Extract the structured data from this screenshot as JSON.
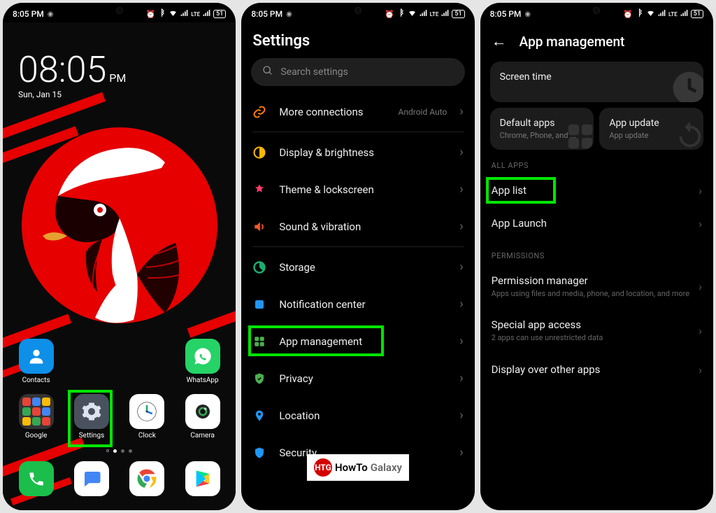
{
  "status": {
    "time": "8:05 PM",
    "battery": "51"
  },
  "home": {
    "clock_time": "08:05",
    "clock_ampm": "PM",
    "clock_date": "Sun, Jan 15",
    "apps_row1": [
      {
        "label": "Contacts"
      },
      {
        "label": ""
      },
      {
        "label": ""
      },
      {
        "label": "WhatsApp"
      }
    ],
    "apps_row2": [
      {
        "label": "Google"
      },
      {
        "label": "Settings"
      },
      {
        "label": "Clock"
      },
      {
        "label": "Camera"
      }
    ],
    "dock": [
      {
        "label": "Phone"
      },
      {
        "label": "Messages"
      },
      {
        "label": "Chrome"
      },
      {
        "label": "Play Store"
      }
    ]
  },
  "settings": {
    "title": "Settings",
    "search_placeholder": "Search settings",
    "items": [
      {
        "label": "More connections",
        "value": "Android Auto"
      },
      {
        "label": "Display & brightness"
      },
      {
        "label": "Theme & lockscreen"
      },
      {
        "label": "Sound & vibration"
      },
      {
        "label": "Storage"
      },
      {
        "label": "Notification center"
      },
      {
        "label": "App management"
      },
      {
        "label": "Privacy"
      },
      {
        "label": "Location"
      },
      {
        "label": "Security"
      }
    ]
  },
  "appmgmt": {
    "title": "App management",
    "cards": {
      "screen_time": "Screen time",
      "default_apps": "Default apps",
      "default_apps_sub": "Chrome, Phone, and ...",
      "app_update": "App update",
      "app_update_sub": "App update"
    },
    "section_all": "ALL APPS",
    "all_apps": [
      {
        "label": "App list"
      },
      {
        "label": "App Launch"
      }
    ],
    "section_perm": "PERMISSIONS",
    "permissions": [
      {
        "label": "Permission manager",
        "sub": "Apps using files and media, phone, and location, and more"
      },
      {
        "label": "Special app access",
        "sub": "2 apps can use unrestricted data"
      },
      {
        "label": "Display over other apps"
      }
    ]
  },
  "logo": {
    "text1": "HowTo",
    "text2": "Galaxy",
    "badge": "HTG"
  }
}
